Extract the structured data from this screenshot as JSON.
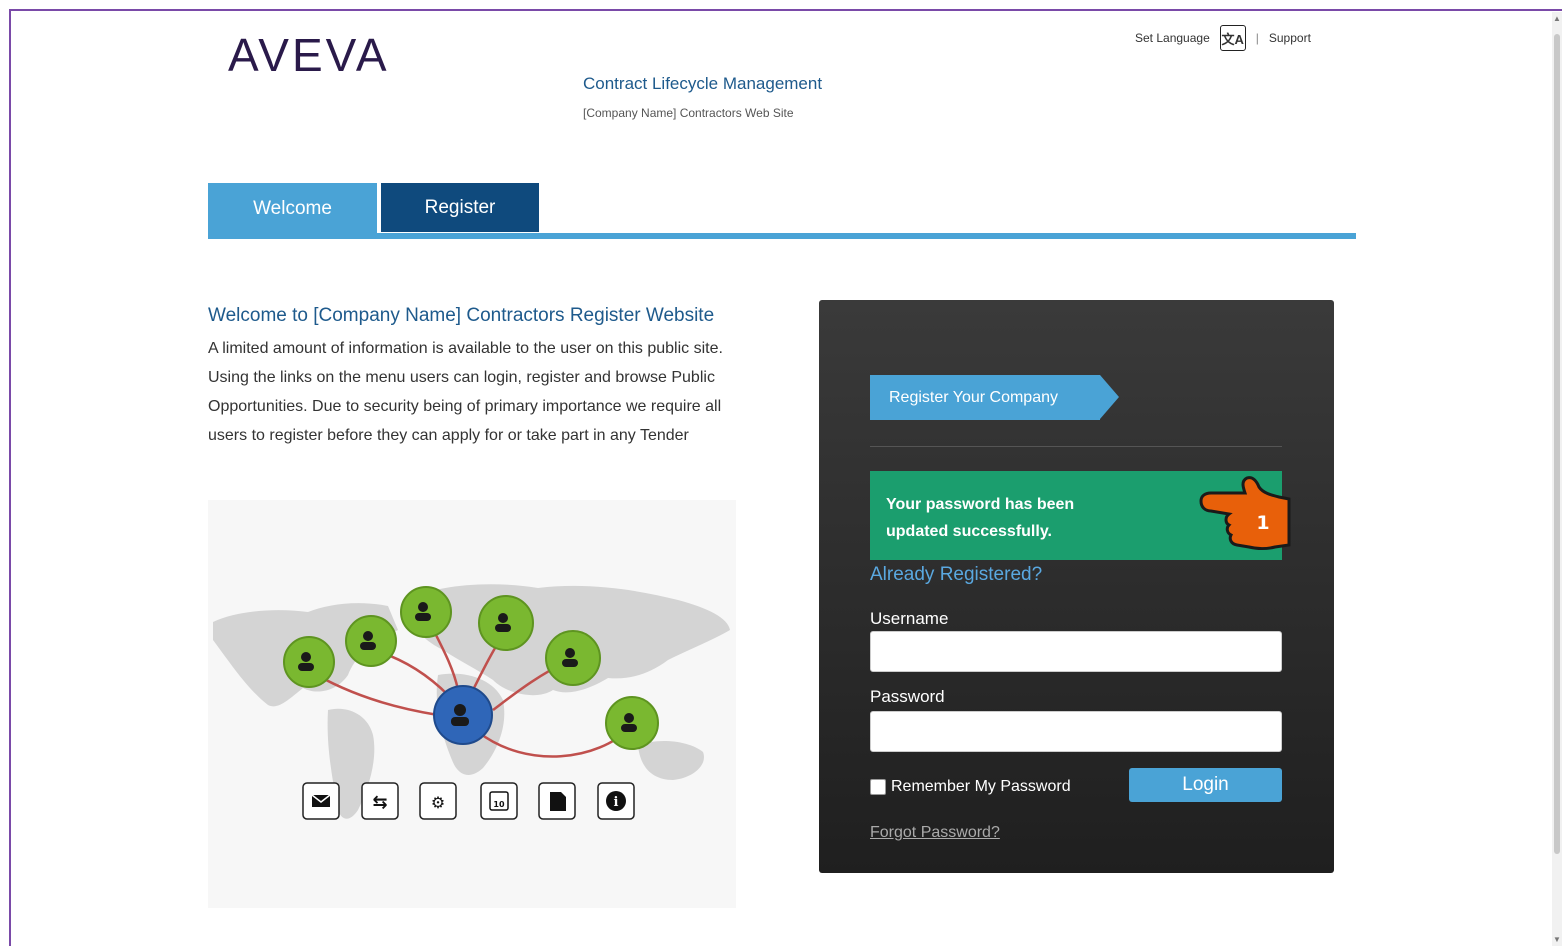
{
  "header": {
    "logo": "AVEVA",
    "app_title": "Contract Lifecycle Management",
    "app_subtitle": "[Company Name] Contractors Web Site",
    "set_language": "Set Language",
    "lang_icon_glyph": "文A",
    "separator": "|",
    "support": "Support"
  },
  "tabs": [
    {
      "label": "Welcome",
      "active": true
    },
    {
      "label": "Register",
      "active": false
    }
  ],
  "welcome": {
    "heading": "Welcome to [Company Name] Contractors Register Website",
    "body": "A limited amount of information is available to the user on this public site. Using the links on the menu users can login, register and browse Public Opportunities. Due to security being of primary importance we require all users to register before they can apply for or take part in any Tender"
  },
  "illustration": {
    "icons": [
      "envelope-icon",
      "exchange-icon",
      "gears-icon",
      "calendar-icon",
      "document-icon",
      "info-icon"
    ],
    "calendar_day": "10"
  },
  "login_panel": {
    "register_company": "Register Your Company",
    "alert_message": "Your password has been updated successfully.",
    "callout_number": "1",
    "already_registered": "Already Registered?",
    "username_label": "Username",
    "username_value": "",
    "password_label": "Password",
    "password_value": "",
    "remember_label": "Remember My Password",
    "remember_checked": false,
    "login_label": "Login",
    "forgot_label": "Forgot Password?"
  },
  "colors": {
    "accent_blue": "#4aa3d6",
    "dark_blue": "#0f4a7d",
    "success_green": "#1b9e6e",
    "panel_dark": "#2a2a2a",
    "callout_orange": "#e8600a"
  }
}
